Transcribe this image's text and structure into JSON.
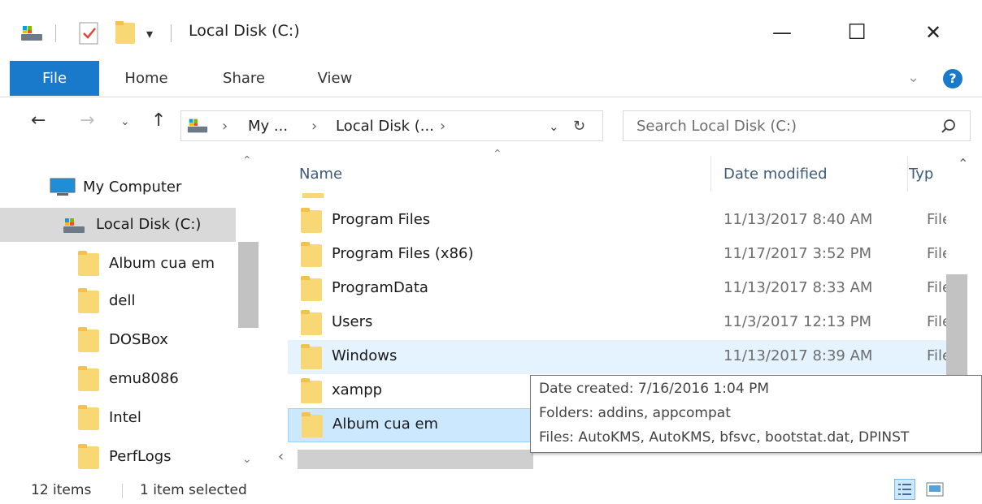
{
  "titlebar": {
    "title": "Local Disk (C:)",
    "icons": [
      "drive-icon",
      "properties-icon",
      "new-folder-icon",
      "customize-quick-access-icon"
    ],
    "controls": {
      "minimize": "—",
      "maximize": "☐",
      "close": "✕"
    }
  },
  "ribbon": {
    "tabs": [
      "File",
      "Home",
      "Share",
      "View"
    ],
    "icons": [
      "chevron-down-icon",
      "help-icon"
    ]
  },
  "nav": {
    "breadcrumb": [
      "My ...",
      "Local Disk (..."
    ],
    "search_placeholder": "Search Local Disk (C:)"
  },
  "tree": [
    {
      "label": "My Computer",
      "icon": "computer-icon"
    },
    {
      "label": "Local Disk (C:)",
      "icon": "drive-icon"
    },
    {
      "label": "Album cua em",
      "icon": "folder-icon"
    },
    {
      "label": "dell",
      "icon": "folder-icon"
    },
    {
      "label": "DOSBox",
      "icon": "folder-icon"
    },
    {
      "label": "emu8086",
      "icon": "folder-icon"
    },
    {
      "label": "Intel",
      "icon": "folder-icon"
    },
    {
      "label": "PerfLogs",
      "icon": "folder-icon"
    }
  ],
  "columns": {
    "name": "Name",
    "date": "Date modified",
    "type": "Typ"
  },
  "files": [
    {
      "name": "Program Files",
      "date": "11/13/2017 8:40 AM",
      "type": "File"
    },
    {
      "name": "Program Files (x86)",
      "date": "11/17/2017 3:52 PM",
      "type": "File"
    },
    {
      "name": "ProgramData",
      "date": "11/13/2017 8:33 AM",
      "type": "File"
    },
    {
      "name": "Users",
      "date": "11/3/2017 12:13 PM",
      "type": "File"
    },
    {
      "name": "Windows",
      "date": "11/13/2017 8:39 AM",
      "type": "File"
    },
    {
      "name": "xampp",
      "date": "",
      "type": ""
    },
    {
      "name": "Album cua em",
      "date": "",
      "type": ""
    }
  ],
  "tooltip": {
    "created": "Date created: 7/16/2016 1:04 PM",
    "folders": "Folders: addins, appcompat",
    "files": "Files: AutoKMS, AutoKMS, bfsvc, bootstat.dat, DPINST"
  },
  "status": {
    "items": "12 items",
    "selected": "1 item selected"
  },
  "colors": {
    "accent": "#1979ca",
    "folder": "#f8d775",
    "hover": "#e5f3ff",
    "selected": "#cce8ff"
  }
}
